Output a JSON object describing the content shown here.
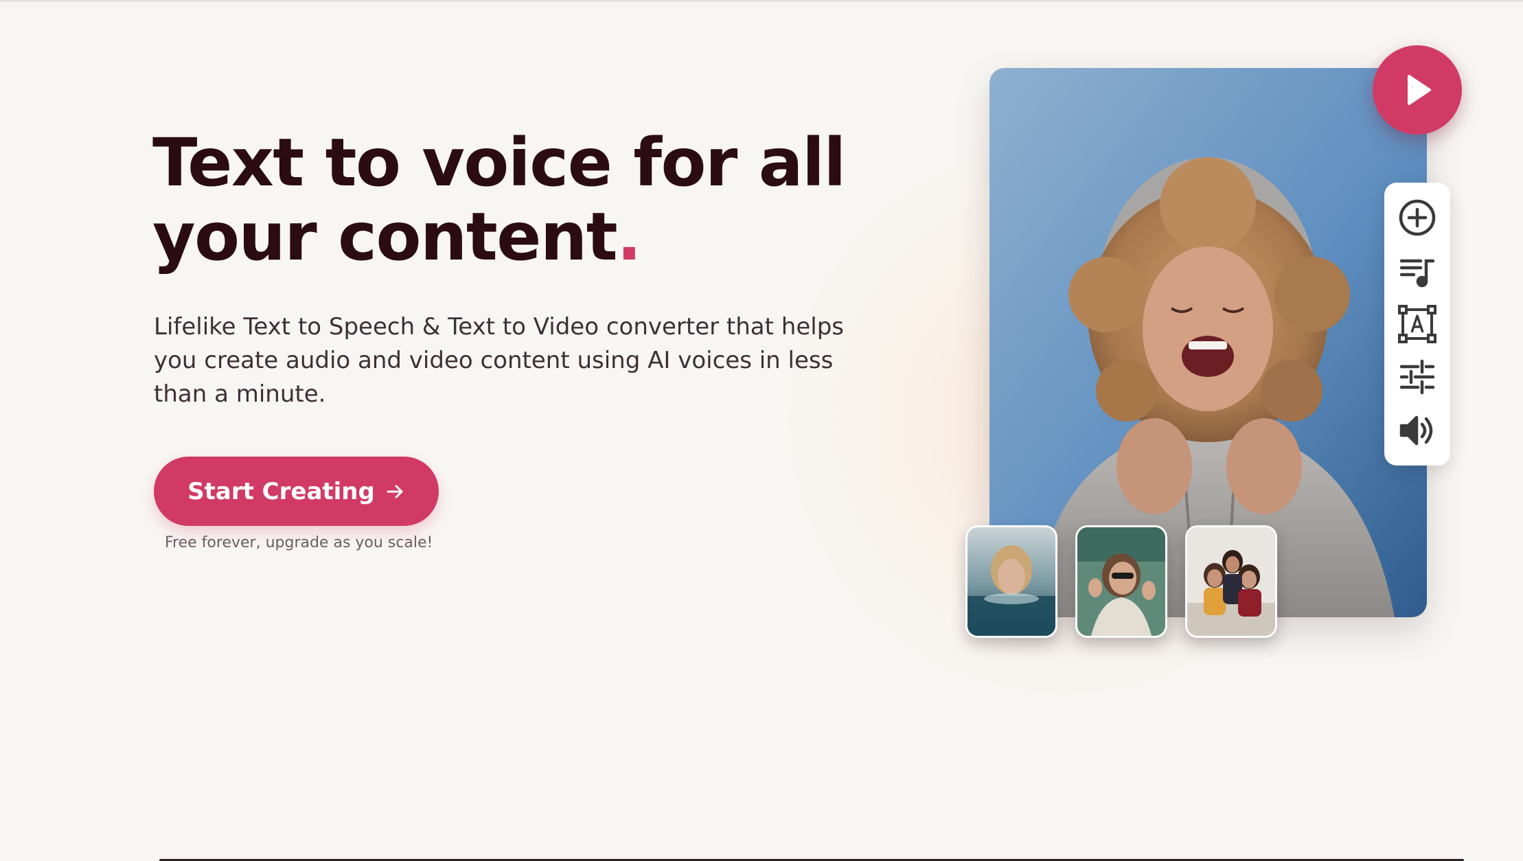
{
  "hero": {
    "title_main": "Text to voice for all your content",
    "title_punct": ".",
    "subtitle": "Lifelike Text to Speech & Text to Video converter that helps you create audio and video content using AI voices in less than a minute.",
    "cta_label": "Start Creating",
    "cta_note": "Free forever, upgrade as you scale!"
  },
  "media": {
    "hero_image_icon": "woman-laughing-photo",
    "play_icon": "play-icon",
    "tools": [
      {
        "name": "add-icon"
      },
      {
        "name": "music-playlist-icon"
      },
      {
        "name": "text-box-icon"
      },
      {
        "name": "sliders-icon"
      },
      {
        "name": "volume-icon"
      }
    ],
    "thumbnails": [
      {
        "name": "woman-in-water-thumbnail"
      },
      {
        "name": "woman-with-sunglasses-thumbnail"
      },
      {
        "name": "three-friends-thumbnail"
      }
    ]
  },
  "colors": {
    "accent": "#d23a66",
    "heading": "#2b0c12",
    "background": "#f8f6f3",
    "body_text": "#3c3035"
  }
}
